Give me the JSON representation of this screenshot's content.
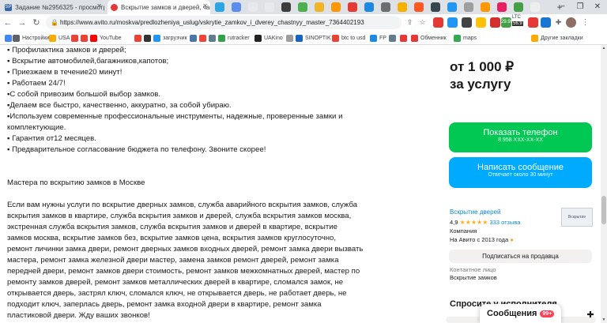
{
  "browser": {
    "tabs": [
      {
        "label": "Задание №2956325 - просмотр з",
        "fav": "SP",
        "fav_color": "#3566a7",
        "active": false
      },
      {
        "label": "Вскрытие замков и дверей, част",
        "fav": "",
        "fav_color": "#e53935",
        "active": true
      }
    ],
    "mini_tab_colors": [
      "#2aa4e3",
      "#5a8dee",
      "#e7e9ec",
      "#e7e9ec",
      "#3c3c3c",
      "#4caf50",
      "#f0b429",
      "#ff9800",
      "#e53935",
      "#1e88e5",
      "#6d6d6d",
      "#f6b100",
      "#ff5722",
      "#37474f",
      "#2196f3",
      "#9e9e9e",
      "#ff9800",
      "#e91e63",
      "#43a047",
      "#eeeeee"
    ],
    "new_tab": "+",
    "url": "https://www.avito.ru/moskva/predlozheniya_uslug/vskrytie_zamkov_i_dverey_chastnyy_master_7364402193",
    "window_controls": [
      "−",
      "❐",
      "✕"
    ],
    "ext_badges": {
      "num": "20",
      "ltc": "LTC",
      "ltc_value": "56.9",
      "ltc_price": "29.99"
    }
  },
  "bookmarks": [
    {
      "label": "",
      "icon": "apps-icon",
      "color": "#4285f4"
    },
    {
      "label": "Настройки",
      "icon": "settings-icon",
      "color": "#5f6368"
    },
    {
      "label": "USA",
      "icon": "folder-icon",
      "color": "#f9ab00"
    },
    {
      "label": "",
      "icon": "google-icon",
      "color": "#ea4335"
    },
    {
      "label": "",
      "icon": "google-icon",
      "color": "#ea4335"
    },
    {
      "label": "YouTube",
      "icon": "youtube-icon",
      "color": "#ff0000"
    },
    {
      "label": "",
      "icon": "google-icon",
      "color": "#ea4335"
    },
    {
      "label": "",
      "icon": "wiki-icon",
      "color": "#333333"
    },
    {
      "label": "загрузчик",
      "icon": "download-icon",
      "color": "#2196f3"
    },
    {
      "label": "",
      "icon": "vk-icon",
      "color": "#4a76a8"
    },
    {
      "label": "",
      "icon": "mail-icon",
      "color": "#f44336"
    },
    {
      "label": "",
      "icon": "globe-icon",
      "color": "#607d8b"
    },
    {
      "label": "rutracker",
      "icon": "rutracker-icon",
      "color": "#31a24c"
    },
    {
      "label": "UAKino",
      "icon": "uakino-icon",
      "color": "#222222"
    },
    {
      "label": "",
      "icon": "tab-icon",
      "color": "#9e9e9e"
    },
    {
      "label": "SINOPTIK",
      "icon": "weather-icon",
      "color": "#1565c0"
    },
    {
      "label": "btc to usd",
      "icon": "google-icon",
      "color": "#ea4335"
    },
    {
      "label": "FP",
      "icon": "fp-icon",
      "color": "#1e88e5"
    },
    {
      "label": "",
      "icon": "bookmark-icon",
      "color": "#607d8b"
    },
    {
      "label": "",
      "icon": "exchange-icon",
      "color": "#e53935"
    },
    {
      "label": "Обменник",
      "icon": "exchange-icon",
      "color": "#e53935"
    },
    {
      "label": "maps",
      "icon": "maps-icon",
      "color": "#34a853"
    },
    {
      "label": "Другие закладки",
      "icon": "folder-icon",
      "color": "#f9ab00"
    }
  ],
  "description": {
    "lines": [
      "▪ Профилактика замков и дверей;",
      "▪ Вскрытие автомобилей,багажников,капотов;",
      "▪ Приезжаем в течение20 минут!",
      "▪ Работаем 24/7!",
      "▪С собой привозим большой выбор замков.",
      "▪Делаем все быстро, качественно, аккуратно, за собой убираю.",
      "▪Используем современные профессиональные инструменты, надежные, проверенные замки и",
      "комплектующие.",
      "▪ Гарантия от12 месяцев.",
      "▪ Предварительное согласование бюджета по телефону. Звоните скорее!",
      "",
      "",
      "Мастера по вскрытию замков в Москве",
      "",
      "Если вам нужны услуги по вскрытие дверных замков, служба аварийного вскрытия замков, служба",
      "вскрытия замков в квартире, служба вскрытия замков и дверей, служба вскрытия замков москва,",
      "экстренная служба вскрытия замков, служба вскрытия замков и дверей в квартире, вскрытие",
      "замков москва, вскрытие замков без, вскрытие замков цена, вскрытия замков круглосуточно,",
      "ремонт личинки замка двери, ремонт дверных замков входных дверей, ремонт замка двери вызвать",
      "мастера, ремонт замка железной двери мастер, замена замков ремонт дверей, ремонт замка",
      "передней двери, ремонт замков двери стоимость, ремонт замков межкомнатных дверей, мастер по",
      "ремонту замков дверей, ремонт замков металлических дверей в квартире, сломался замок, не",
      "открывается дверь, застрял ключ, сломался ключ, не открывается дверь, не работает дверь, не",
      "подходит ключ, заперлась дверь, ремонт замка входной двери в квартире, ремонт замка",
      "пластиковой двери. Жду ваших звонков!"
    ]
  },
  "sidebar": {
    "price_line1": "от 1 000 ₽",
    "price_line2": "за услугу",
    "call_button": {
      "label": "Показать телефон",
      "sub": "8 958 XXX-XX-XX",
      "color": "#00c853"
    },
    "message_button": {
      "label": "Написать сообщение",
      "sub": "Отвечает около 30 минут",
      "color": "#00aaff"
    },
    "seller": {
      "name": "Вскрытие дверей",
      "rating": "4,9",
      "stars": "★★★★★",
      "reviews": "333 отзыва",
      "type": "Компания",
      "since": "На Авито с 2013 года",
      "logo_text": "Вскрытие"
    },
    "subscribe_label": "Подписаться на продавца",
    "contact_label": "Контактное лицо",
    "contact_value": "Вскрытие замков",
    "ask_title": "Спросите у исполнителя"
  },
  "chat_widget": {
    "label": "Сообщения",
    "badge": "99+"
  },
  "fab_icon": "plus-icon"
}
